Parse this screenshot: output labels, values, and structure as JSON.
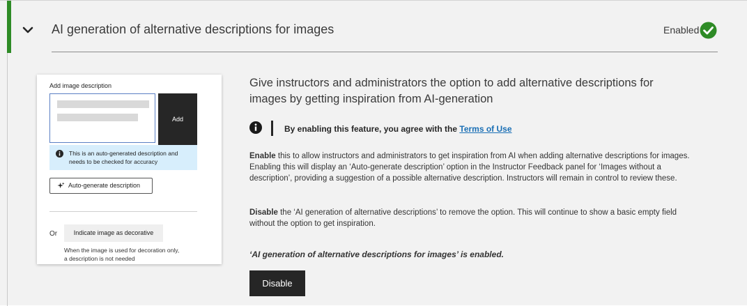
{
  "section": {
    "title": "AI generation of alternative descriptions for images",
    "status_label": "Enabled",
    "colors": {
      "accent": "#2e8b26",
      "check": "#2e8b26"
    }
  },
  "preview": {
    "label": "Add image description",
    "add_label": "Add",
    "note": "This is an auto-generated description and needs to be checked for accuracy",
    "auto_label": "Auto-generate description",
    "or_label": "Or",
    "decorative_label": "Indicate image as decorative",
    "decorative_note": "When the image is used for decoration only, a description is not needed"
  },
  "content": {
    "heading": "Give instructors and administrators the option to add alternative descriptions for images by getting inspiration from AI-generation",
    "terms_prefix": "By enabling this feature, you agree with the ",
    "terms_link": "Terms of Use",
    "enable_bold": "Enable",
    "enable_text": " this to allow instructors and administrators to get inspiration from AI when adding alternative descriptions for images. Enabling this will display an ‘Auto-generate description’ option in the Instructor Feedback panel for ‘Images without a description’, providing a suggestion of a possible alternative description. Instructors will remain in control to review these.",
    "disable_bold": "Disable",
    "disable_text": " the ‘AI generation of alternative descriptions’ to remove the option. This will continue to show a basic empty field without the option to get inspiration.",
    "state_text": "‘AI generation of alternative descriptions for images’ is enabled.",
    "button_label": "Disable"
  },
  "icons": [
    "chevron-down-icon",
    "check-circle-icon",
    "info-icon",
    "sparkle-icon"
  ]
}
